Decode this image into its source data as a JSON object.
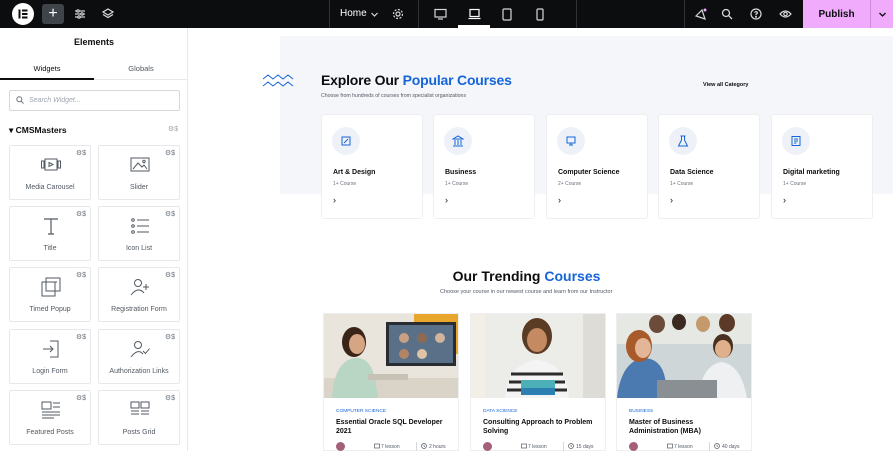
{
  "topbar": {
    "page": "Home",
    "publish": "Publish",
    "icons": [
      "elementor-logo-icon",
      "add-element-icon",
      "site-settings-icon",
      "structure-layers-icon",
      "chevron-down-icon",
      "settings-gear-icon",
      "desktop-icon",
      "laptop-icon",
      "tablet-icon",
      "mobile-icon",
      "whats-new-icon",
      "search-icon",
      "help-icon",
      "preview-eye-icon",
      "chevron-down-icon"
    ]
  },
  "panel": {
    "title": "Elements",
    "tabs": [
      "Widgets",
      "Globals"
    ],
    "search_placeholder": "Search Widget...",
    "category": "CMSMasters",
    "widgets": [
      {
        "label": "Media Carousel",
        "icon": "media-carousel-icon"
      },
      {
        "label": "Slider",
        "icon": "slider-icon"
      },
      {
        "label": "Title",
        "icon": "title-icon"
      },
      {
        "label": "Icon List",
        "icon": "icon-list-icon"
      },
      {
        "label": "Timed Popup",
        "icon": "timed-popup-icon"
      },
      {
        "label": "Registration Form",
        "icon": "registration-form-icon"
      },
      {
        "label": "Login Form",
        "icon": "login-form-icon"
      },
      {
        "label": "Authorization Links",
        "icon": "authorization-links-icon"
      },
      {
        "label": "Featured Posts",
        "icon": "featured-posts-icon"
      },
      {
        "label": "Posts Grid",
        "icon": "posts-grid-icon"
      }
    ]
  },
  "popular": {
    "title_a": "Explore Our ",
    "title_b": "Popular Courses",
    "subtitle": "Choose from hundreds of courses from specialist organizations",
    "view_all": "View all Category",
    "categories": [
      {
        "name": "Art & Design",
        "count": "1+ Course"
      },
      {
        "name": "Business",
        "count": "1+ Course"
      },
      {
        "name": "Computer Science",
        "count": "2+ Course"
      },
      {
        "name": "Data Science",
        "count": "1+ Course"
      },
      {
        "name": "Digital marketing",
        "count": "1+ Course"
      }
    ]
  },
  "trending": {
    "title_a": "Our Trending ",
    "title_b": "Courses",
    "subtitle": "Choose your course in our newest course and learn from our Instructor",
    "courses": [
      {
        "tag": "COMPUTER SCIENCE",
        "title": "Essential Oracle SQL Developer 2021",
        "lessons": "7 lesson",
        "duration": "2 hours"
      },
      {
        "tag": "DATA SCIENCE",
        "title": "Consulting Approach to Problem Solving",
        "lessons": "7 lesson",
        "duration": "15 days"
      },
      {
        "tag": "BUSINESS",
        "title": "Master of Business Administration (MBA)",
        "lessons": "7 lesson",
        "duration": "40 days"
      }
    ]
  },
  "colors": {
    "accent": "#1565d8",
    "publish": "#f0abfc",
    "topbar": "#0c0d0e"
  }
}
